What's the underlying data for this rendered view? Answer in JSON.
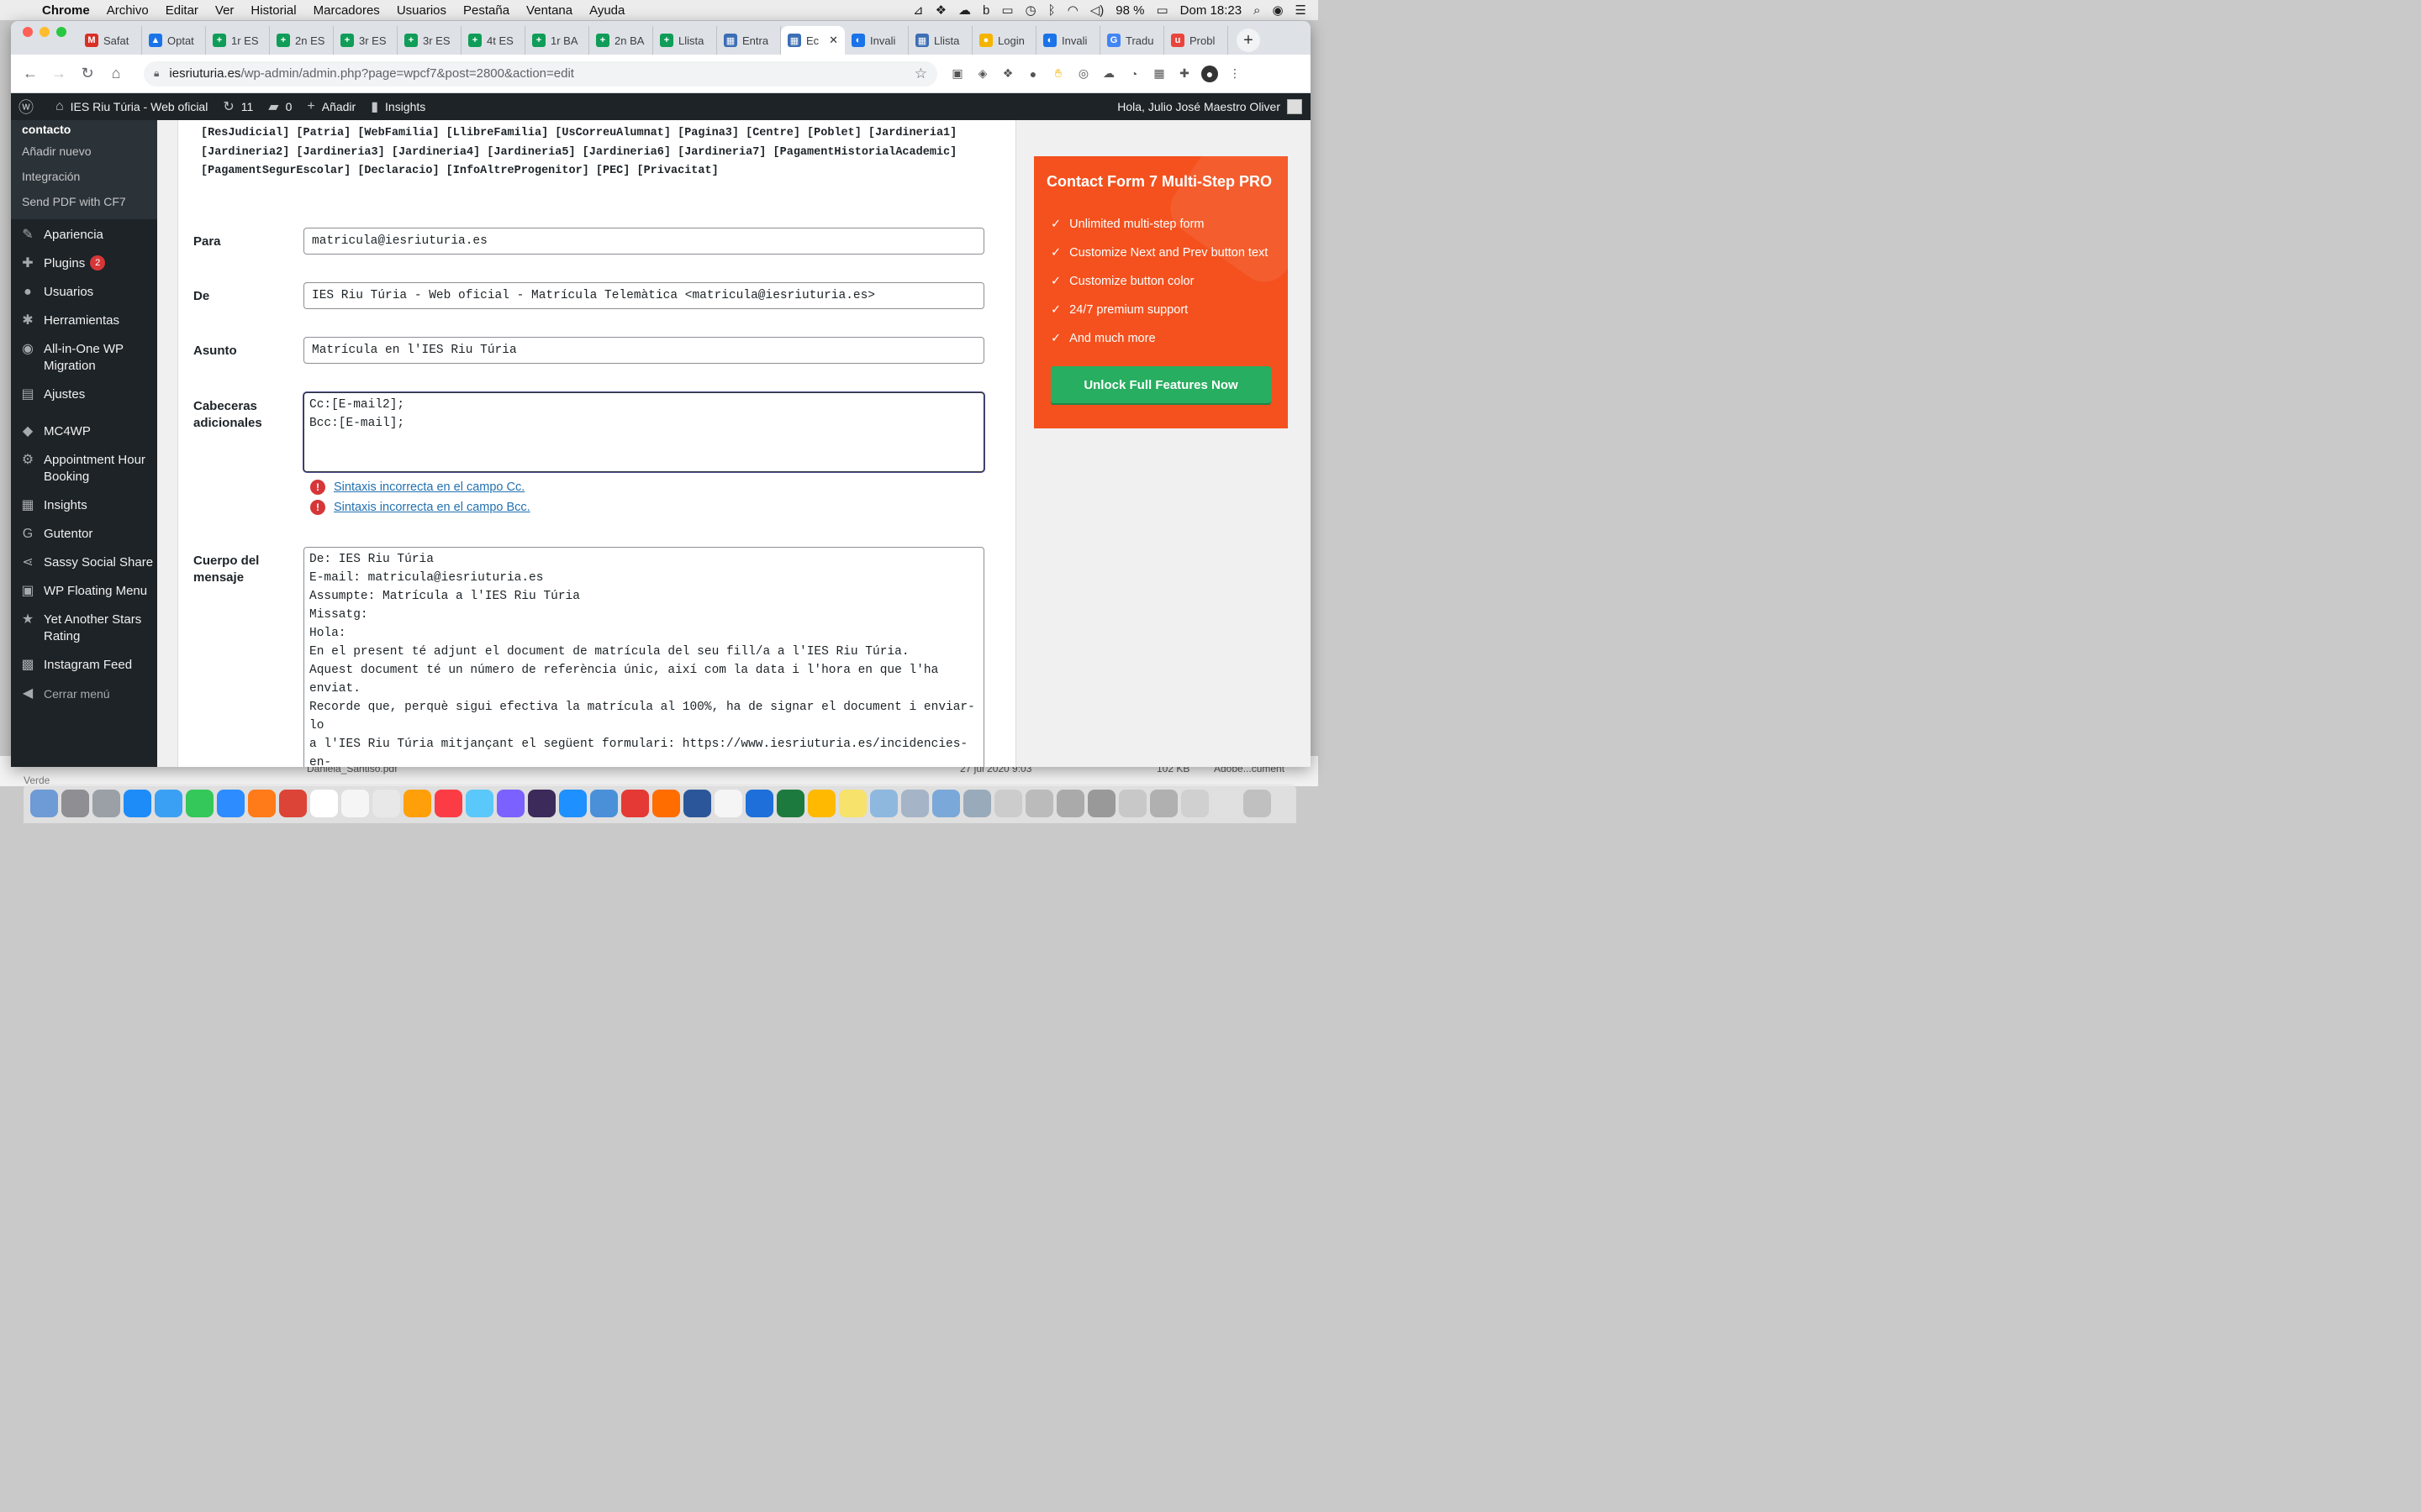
{
  "menubar": {
    "app": "Chrome",
    "menus": [
      "Archivo",
      "Editar",
      "Ver",
      "Historial",
      "Marcadores",
      "Usuarios",
      "Pestaña",
      "Ventana",
      "Ayuda"
    ],
    "battery": "98 %",
    "clock": "Dom 18:23"
  },
  "tabs": [
    {
      "label": "Safat",
      "color": "#d93025",
      "glyph": "M"
    },
    {
      "label": "Optat",
      "color": "#1a73e8",
      "glyph": "▲"
    },
    {
      "label": "1r ES",
      "color": "#0f9d58",
      "glyph": "+"
    },
    {
      "label": "2n ES",
      "color": "#0f9d58",
      "glyph": "+"
    },
    {
      "label": "3r ES",
      "color": "#0f9d58",
      "glyph": "+"
    },
    {
      "label": "3r ES",
      "color": "#0f9d58",
      "glyph": "+"
    },
    {
      "label": "4t ES",
      "color": "#0f9d58",
      "glyph": "+"
    },
    {
      "label": "1r BA",
      "color": "#0f9d58",
      "glyph": "+"
    },
    {
      "label": "2n BA",
      "color": "#0f9d58",
      "glyph": "+"
    },
    {
      "label": "Llista",
      "color": "#0f9d58",
      "glyph": "+"
    },
    {
      "label": "Entra",
      "color": "#3c6eb4",
      "glyph": "▦"
    },
    {
      "label": "Ec",
      "color": "#3c6eb4",
      "glyph": "▦",
      "active": true
    },
    {
      "label": "Invali",
      "color": "#1a73e8",
      "glyph": "◐"
    },
    {
      "label": "Llista",
      "color": "#3c6eb4",
      "glyph": "▦"
    },
    {
      "label": "Login",
      "color": "#f4b400",
      "glyph": "●"
    },
    {
      "label": "Invali",
      "color": "#1a73e8",
      "glyph": "◐"
    },
    {
      "label": "Tradu",
      "color": "#4285f4",
      "glyph": "G"
    },
    {
      "label": "Probl",
      "color": "#e8453c",
      "glyph": "u"
    }
  ],
  "address": {
    "host": "iesriuturia.es",
    "path": "/wp-admin/admin.php?page=wpcf7&post=2800&action=edit"
  },
  "adminbar": {
    "site": "IES Riu Túria - Web oficial",
    "updates": "11",
    "comments": "0",
    "add_new": "Añadir",
    "insights": "Insights",
    "howdy": "Hola, Julio José Maestro Oliver"
  },
  "sidebar": {
    "submenu_head": "contacto",
    "submenu": [
      "Añadir nuevo",
      "Integración",
      "Send PDF with CF7"
    ],
    "items": [
      {
        "label": "Apariencia",
        "icon": "paintbrush-icon",
        "glyph": "✎"
      },
      {
        "label": "Plugins",
        "icon": "plugin-icon",
        "glyph": "✚",
        "badge": "2"
      },
      {
        "label": "Usuarios",
        "icon": "users-icon",
        "glyph": "●"
      },
      {
        "label": "Herramientas",
        "icon": "wrench-icon",
        "glyph": "✱"
      },
      {
        "label": "All-in-One WP\nMigration",
        "icon": "migration-icon",
        "glyph": "◉"
      },
      {
        "label": "Ajustes",
        "icon": "settings-icon",
        "glyph": "▤"
      },
      {
        "label": "MC4WP",
        "icon": "mc4wp-icon",
        "glyph": "◆"
      },
      {
        "label": "Appointment Hour\nBooking",
        "icon": "gear-icon",
        "glyph": "⚙"
      },
      {
        "label": "Insights",
        "icon": "insights-icon",
        "glyph": "▦"
      },
      {
        "label": "Gutentor",
        "icon": "gutentor-icon",
        "glyph": "G"
      },
      {
        "label": "Sassy Social Share",
        "icon": "share-icon",
        "glyph": "⋖"
      },
      {
        "label": "WP Floating Menu",
        "icon": "menu-icon",
        "glyph": "▣"
      },
      {
        "label": "Yet Another Stars\nRating",
        "icon": "star-icon",
        "glyph": "★"
      },
      {
        "label": "Instagram Feed",
        "icon": "camera-icon",
        "glyph": "▩"
      }
    ],
    "collapse": "Cerrar menú"
  },
  "form": {
    "tags_line1": "[ResJudicial] [Patria] [WebFamilia] [LlibreFamilia] [UsCorreuAlumnat] [Pagina3] [Centre] [Poblet] [Jardineria1]",
    "tags_line2": "[Jardineria2] [Jardineria3] [Jardineria4] [Jardineria5] [Jardineria6] [Jardineria7] [PagamentHistorialAcademic]",
    "tags_line3": "[PagamentSegurEscolar] [Declaracio] [InfoAltreProgenitor] [PEC] [Privacitat]",
    "to_label": "Para",
    "to_value": "matricula@iesriuturia.es",
    "from_label": "De",
    "from_value": "IES Riu Túria - Web oficial - Matrícula Telemàtica <matricula@iesriuturia.es>",
    "subject_label": "Asunto",
    "subject_value": "Matrícula en l'IES Riu Túria",
    "headers_label": "Cabeceras adicionales",
    "headers_value": "Cc:[E-mail2];\nBcc:[E-mail];",
    "error_cc": "Sintaxis incorrecta en el campo Cc.",
    "error_bcc": "Sintaxis incorrecta en el campo Bcc.",
    "body_label": "Cuerpo del mensaje",
    "body_value": "De: IES Riu Túria\nE-mail: matricula@iesriuturia.es\nAssumpte: Matrícula a l'IES Riu Túria\nMissatg:\nHola:\nEn el present té adjunt el document de matrícula del seu fill/a a l'IES Riu Túria.\nAquest document té un número de referència únic, així com la data i l'hora en que l'ha enviat.\nRecorde que, perquè sigui efectiva la matrícula al 100%, ha de signar el document i enviar-lo\na l'IES Riu Túria mitjançant el següent formulari: https://www.iesriuturia.es/incidencies-en-\nla-matricula/ o al correu electrònic: matricula@iesriuturia.es, en els deu dies posteriors a\nla seva recepció.\nMoltes gràcies per la seva atenció i col·laboració.\nIES Riu Túria"
  },
  "promo": {
    "title": "Contact Form 7 Multi-Step PRO",
    "features": [
      "Unlimited multi-step form",
      "Customize Next and Prev button text",
      "Customize button color",
      "24/7 premium support",
      "And much more"
    ],
    "cta": "Unlock Full Features Now",
    "bg": "#f4511e",
    "cta_bg": "#27ae60"
  },
  "desktop": {
    "file_name": "Daniela_Santiso.pdf",
    "file_date": "27 jul 2020 9:03",
    "file_size": "102 KB",
    "file_app": "Adobe...cument",
    "tag": "Verde"
  },
  "dock": [
    "#6e9ad6",
    "#8e8e93",
    "#9aa0a6",
    "#1d8cf8",
    "#3aa0f3",
    "#34c759",
    "#2d8cff",
    "#ff7a18",
    "#db4437",
    "#ffffff",
    "#f5f5f5",
    "#e8e8e8",
    "#ff9f0a",
    "#fc3c44",
    "#5ac8fa",
    "#7b61ff",
    "#3b2a5a",
    "#1e90ff",
    "#4a90d9",
    "#e53935",
    "#ff6d00",
    "#2b579a",
    "#f5f5f5",
    "#1e6fd9",
    "#1d7a3e",
    "#ffb900",
    "#f7e26b",
    "#8fb8de",
    "#a6b4c8",
    "#7aa8d8",
    "#9ab",
    "#ccc",
    "#bbb",
    "#aaa",
    "#999",
    "#c8c8c8",
    "#b0b0b0",
    "#d0d0d0",
    "#e0e0e0",
    "#c0c0c0"
  ]
}
